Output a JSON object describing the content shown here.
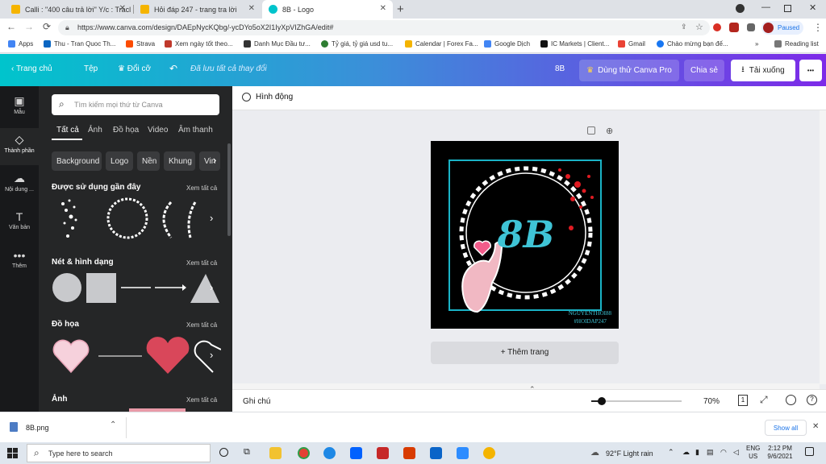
{
  "browser": {
    "tabs": [
      {
        "title": "Calli : \"400 câu trả lời\" Y/c : Tracl",
        "favicon_color": "#f5b400"
      },
      {
        "title": "Hỏi đáp 247 - trang tra lời",
        "favicon_color": "#f5b400"
      },
      {
        "title": "8B - Logo",
        "favicon_color": "#00c4cc"
      }
    ],
    "new_tab": "+",
    "url": "https://www.canva.com/design/DAEpNycKQbg/-ycDYo5oX2I1IyXpVIZhGA/edit#",
    "profile_status": "Paused",
    "bookmarks": [
      "Apps",
      "Thu - Tran Quoc Th...",
      "Strava",
      "Xem ngày tốt theo...",
      "Danh Mục Đầu tư...",
      "Tỷ giá, tỷ giá usd tu...",
      "Calendar | Forex Fa...",
      "Google Dịch",
      "IC Markets | Client...",
      "Gmail",
      "Chào mừng bạn đế..."
    ],
    "reading_list": "Reading list",
    "overflow": "»"
  },
  "canva_header": {
    "home": "Trang chủ",
    "file": "Tệp",
    "resize": "Đổi cỡ",
    "saved": "Đã lưu tất cả thay đổi",
    "design_name": "8B",
    "try_pro": "Dùng thử Canva Pro",
    "share": "Chia sẻ",
    "download": "Tải xuống",
    "more": "•••"
  },
  "rail": [
    {
      "label": "Mẫu",
      "icon": "layout-icon"
    },
    {
      "label": "Thành phần",
      "icon": "shapes-icon"
    },
    {
      "label": "Nội dung ...",
      "icon": "upload-icon"
    },
    {
      "label": "Văn bản",
      "icon": "text-icon"
    },
    {
      "label": "Thêm",
      "icon": "more-icon"
    }
  ],
  "panel": {
    "search_placeholder": "Tìm kiếm mọi thứ từ Canva",
    "tabs": [
      "Tất cả",
      "Ảnh",
      "Đồ họa",
      "Video",
      "Âm thanh"
    ],
    "chips": [
      "Background",
      "Logo",
      "Nền",
      "Khung",
      "Vin"
    ],
    "sections": [
      {
        "title": "Được sử dụng gần đây",
        "see_all": "Xem tất cả"
      },
      {
        "title": "Nét & hình dạng",
        "see_all": "Xem tất cả"
      },
      {
        "title": "Đồ họa",
        "see_all": "Xem tất cả"
      },
      {
        "title": "Ảnh",
        "see_all": "Xem tất cả"
      }
    ]
  },
  "editor": {
    "animate": "Hình động",
    "logo_text": "8B",
    "credit_line1": "NGUYENTHOI88",
    "credit_line2": "#HOIDAP247",
    "add_page": "+ Thêm trang",
    "notes": "Ghi chú",
    "zoom": "70%",
    "zoom_fraction": 0.12,
    "page_count": "1"
  },
  "downloads": {
    "file": "8B.png",
    "show_all": "Show all"
  },
  "taskbar": {
    "search": "Type here to search",
    "weather": "92°F  Light rain",
    "lang1": "ENG",
    "lang2": "US",
    "time": "2:12 PM",
    "date": "9/6/2021"
  }
}
